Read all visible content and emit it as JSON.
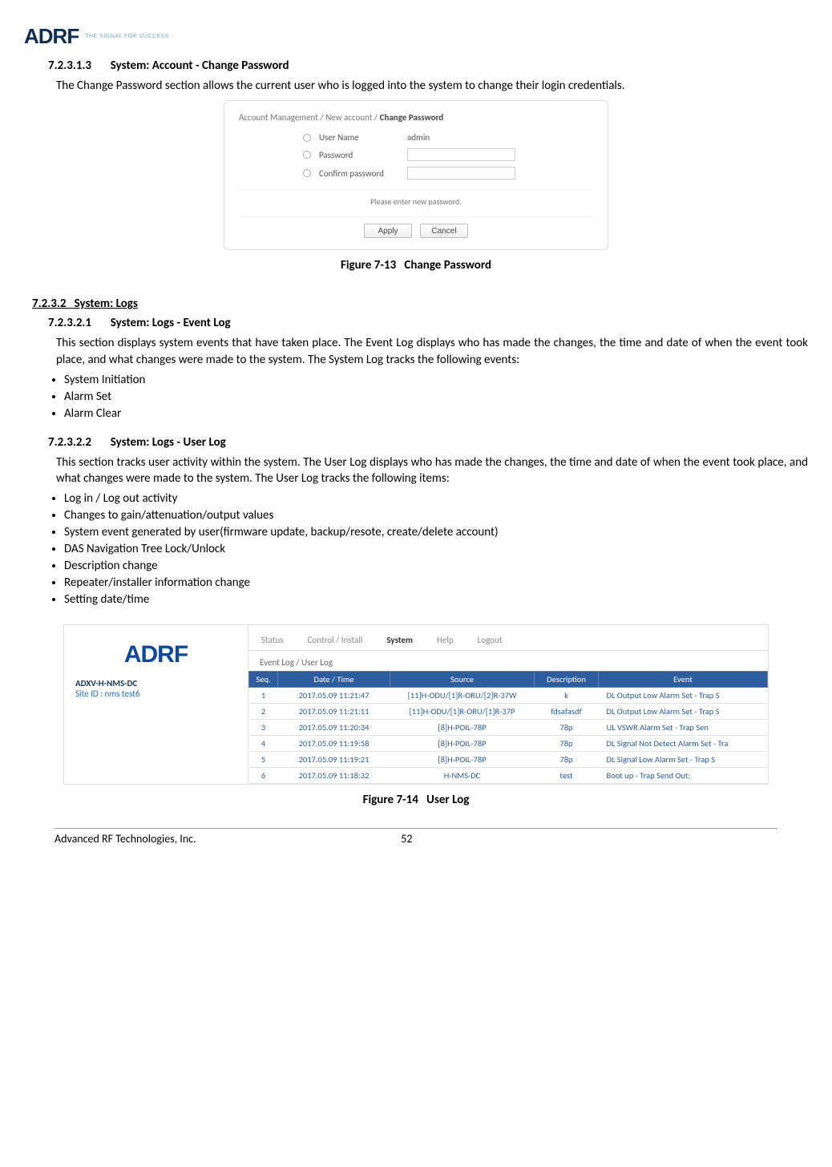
{
  "header": {
    "logo": "ADRF",
    "tagline": "THE SIGNAL FOR SUCCESS"
  },
  "sec_7_2_3_1_3": {
    "num": "7.2.3.1.3",
    "title": "System: Account - Change Password",
    "body": "The Change Password section allows the current user who is logged into the system to change their login credentials."
  },
  "fig_7_13": {
    "caption_num": "Figure 7-13",
    "caption_title": "Change Password",
    "crumb_prefix": "Account Management / New account / ",
    "crumb_active": "Change Password",
    "fields": {
      "username_label": "User Name",
      "username_value": "admin",
      "password_label": "Password",
      "confirm_label": "Confirm password"
    },
    "message": "Please enter new password.",
    "buttons": {
      "apply": "Apply",
      "cancel": "Cancel"
    }
  },
  "sec_7_2_3_2": {
    "num": "7.2.3.2",
    "title": "System: Logs"
  },
  "sec_7_2_3_2_1": {
    "num": "7.2.3.2.1",
    "title": "System: Logs - Event Log",
    "body": "This section displays system events that have taken place. The Event Log displays who has made the changes, the time and date of when the event took place, and what changes were made to the system. The System Log tracks the following events:",
    "items": [
      "System Initiation",
      "Alarm Set",
      "Alarm Clear"
    ]
  },
  "sec_7_2_3_2_2": {
    "num": "7.2.3.2.2",
    "title": "System: Logs - User Log",
    "body": "This section tracks user activity within the system.  The User Log displays who has made the changes, the time and date of when the event took place, and what changes were made to the system. The User Log tracks the following items:",
    "items": [
      "Log in / Log out activity",
      "Changes to gain/attenuation/output values",
      "System event generated by user(firmware update, backup/resote, create/delete account)",
      "DAS Navigation Tree Lock/Unlock",
      "Description change",
      "Repeater/installer information change",
      "Setting date/time"
    ]
  },
  "fig_7_14": {
    "caption_num": "Figure 7-14",
    "caption_title": "User Log",
    "sidebar": {
      "logo": "ADRF",
      "system": "ADXV-H-NMS-DC",
      "site": "Site ID : nms test6"
    },
    "tabs": [
      "Status",
      "Control / Install",
      "System",
      "Help",
      "Logout"
    ],
    "subtab": "Event Log / User Log",
    "columns": {
      "seq": "Seq.",
      "dt": "Date / Time",
      "src": "Source",
      "desc": "Description",
      "ev": "Event"
    },
    "rows": [
      {
        "seq": "1",
        "dt": "2017.05.09 11:21:47",
        "src": "[11]H-ODU/[1]R-ORU/[2]R-37W",
        "desc": "k",
        "ev": "DL Output Low Alarm Set - Trap S"
      },
      {
        "seq": "2",
        "dt": "2017.05.09 11:21:11",
        "src": "[11]H-ODU/[1]R-ORU/[1]R-37P",
        "desc": "fdsafasdf",
        "ev": "DL Output Low Alarm Set - Trap S"
      },
      {
        "seq": "3",
        "dt": "2017.05.09 11:20:34",
        "src": "[8]H-POIL-78P",
        "desc": "78p",
        "ev": "UL VSWR Alarm Set - Trap Sen"
      },
      {
        "seq": "4",
        "dt": "2017.05.09 11:19:58",
        "src": "[8]H-POIL-78P",
        "desc": "78p",
        "ev": "DL Signal Not Detect Alarm Set - Tra"
      },
      {
        "seq": "5",
        "dt": "2017.05.09 11:19:21",
        "src": "[8]H-POIL-78P",
        "desc": "78p",
        "ev": "DL Signal Low Alarm Set - Trap S"
      },
      {
        "seq": "6",
        "dt": "2017.05.09 11:18:32",
        "src": "H-NMS-DC",
        "desc": "test",
        "ev": "Boot up - Trap Send Out;"
      }
    ]
  },
  "footer": {
    "company": "Advanced RF Technologies, Inc.",
    "page": "52"
  }
}
